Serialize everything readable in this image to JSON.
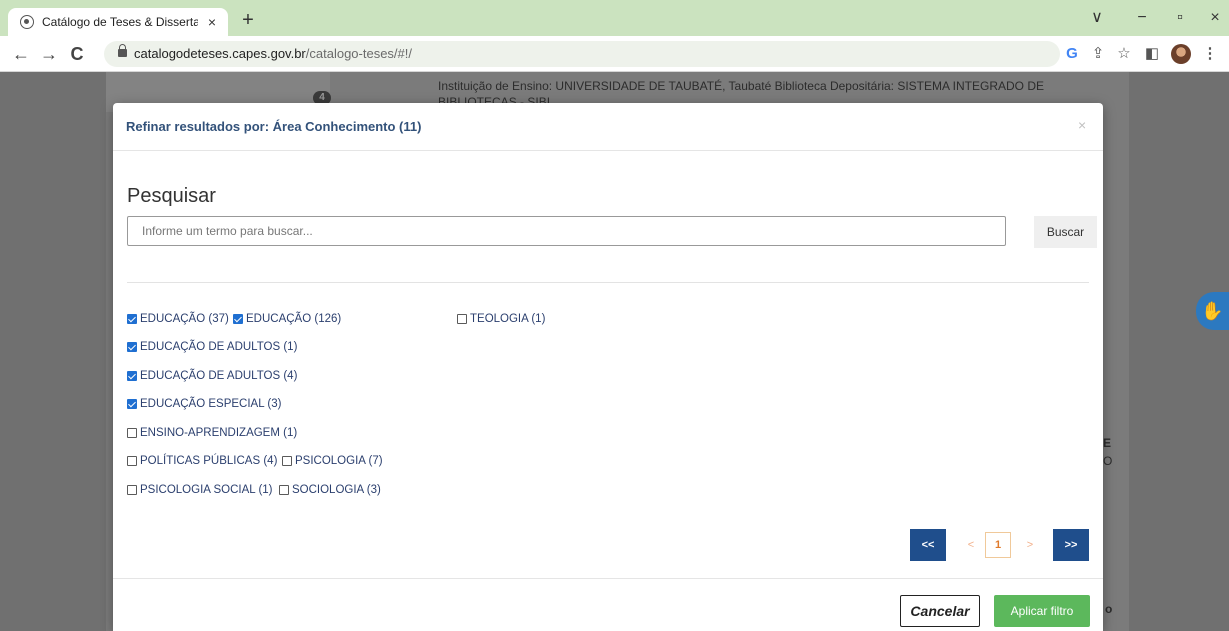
{
  "browser": {
    "tab_title": "Catálogo de Teses & Dissertaçõe",
    "tab_close": "×",
    "new_tab": "+",
    "url_host": "catalogodeteses.capes.gov.br",
    "url_path": "/catalogo-teses/#!/",
    "nav": {
      "back": "←",
      "forward": "→",
      "reload": "C"
    },
    "window": {
      "dropdown": "∨",
      "minimize": "−",
      "restore": "▫",
      "close": "×"
    },
    "actions": {
      "google": "G",
      "share": "⇪",
      "star": "☆",
      "sidepanel": "◧",
      "menu": "⋮"
    }
  },
  "background_page": {
    "badge": "4",
    "institution_text": "Instituição de Ensino: UNIVERSIDADE DE TAUBATÉ, Taubaté Biblioteca Depositária: SISTEMA INTEGRADO DE BIBLIOTECAS - SIBI",
    "fragment_e": "E",
    "fragment_o1": "O",
    "fragment_o2": "o"
  },
  "modal": {
    "title": "Refinar resultados por: Área Conhecimento (11)",
    "close": "×",
    "search_heading": "Pesquisar",
    "search_placeholder": "Informe um termo para buscar...",
    "search_button": "Buscar",
    "facets": [
      {
        "label": "EDUCAÇÃO (37)",
        "checked": true
      },
      {
        "label": "EDUCAÇÃO (126)",
        "checked": true
      },
      {
        "label": "TEOLOGIA (1)",
        "checked": false
      },
      {
        "label": "EDUCAÇÃO DE ADULTOS (1)",
        "checked": true
      },
      {
        "label": "EDUCAÇÃO DE ADULTOS (4)",
        "checked": true
      },
      {
        "label": "EDUCAÇÃO ESPECIAL (3)",
        "checked": true
      },
      {
        "label": "ENSINO-APRENDIZAGEM (1)",
        "checked": false
      },
      {
        "label": "POLÍTICAS PÚBLICAS (4)",
        "checked": false
      },
      {
        "label": "PSICOLOGIA (7)",
        "checked": false
      },
      {
        "label": "PSICOLOGIA SOCIAL (1)",
        "checked": false
      },
      {
        "label": "SOCIOLOGIA (3)",
        "checked": false
      }
    ],
    "pagination": {
      "first": "<<",
      "prev": "<",
      "current": "1",
      "next": ">",
      "last": ">>"
    },
    "cancel_button": "Cancelar",
    "apply_button": "Aplicar filtro"
  },
  "colors": {
    "tab_strip": "#cbe3bf",
    "modal_title": "#33527a",
    "pager_blue": "#1f4e8c",
    "apply_green": "#5cb85c",
    "checkbox_blue": "#1f6fd1"
  }
}
